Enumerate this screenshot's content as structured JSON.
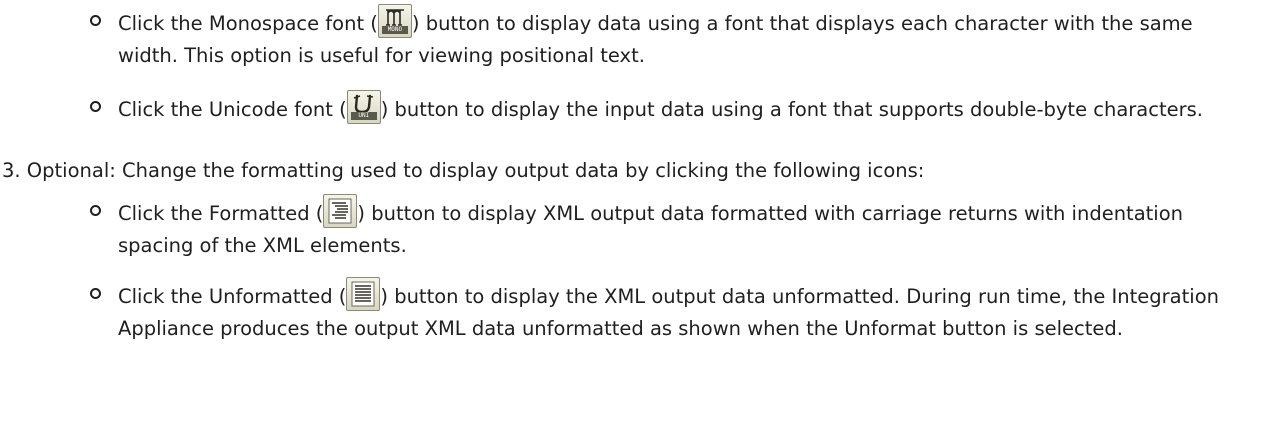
{
  "items": [
    {
      "type": "bullet",
      "prefix": "Click the Monospace font (",
      "icon": "monospace-font-icon",
      "icon_label": "MONO",
      "suffix": ") button to display data using a font that displays each character with the same width. This option is useful for viewing positional text."
    },
    {
      "type": "bullet",
      "prefix": "Click the Unicode font (",
      "icon": "unicode-font-icon",
      "icon_label": "UNI",
      "suffix": ") button to display the input data using a font that supports double-byte characters."
    },
    {
      "type": "numbered",
      "text": "3. Optional: Change the formatting used to display output data by clicking the following icons:"
    },
    {
      "type": "bullet",
      "prefix": "Click the Formatted (",
      "icon": "formatted-icon",
      "suffix": ") button to display XML output data formatted with carriage returns with indentation spacing of the XML elements."
    },
    {
      "type": "bullet",
      "prefix": "Click the Unformatted (",
      "icon": "unformatted-icon",
      "suffix": ") button to display the XML output data unformatted. During run time, the Integration Appliance produces the output XML data unformatted as shown when the Unformat button is selected."
    }
  ]
}
